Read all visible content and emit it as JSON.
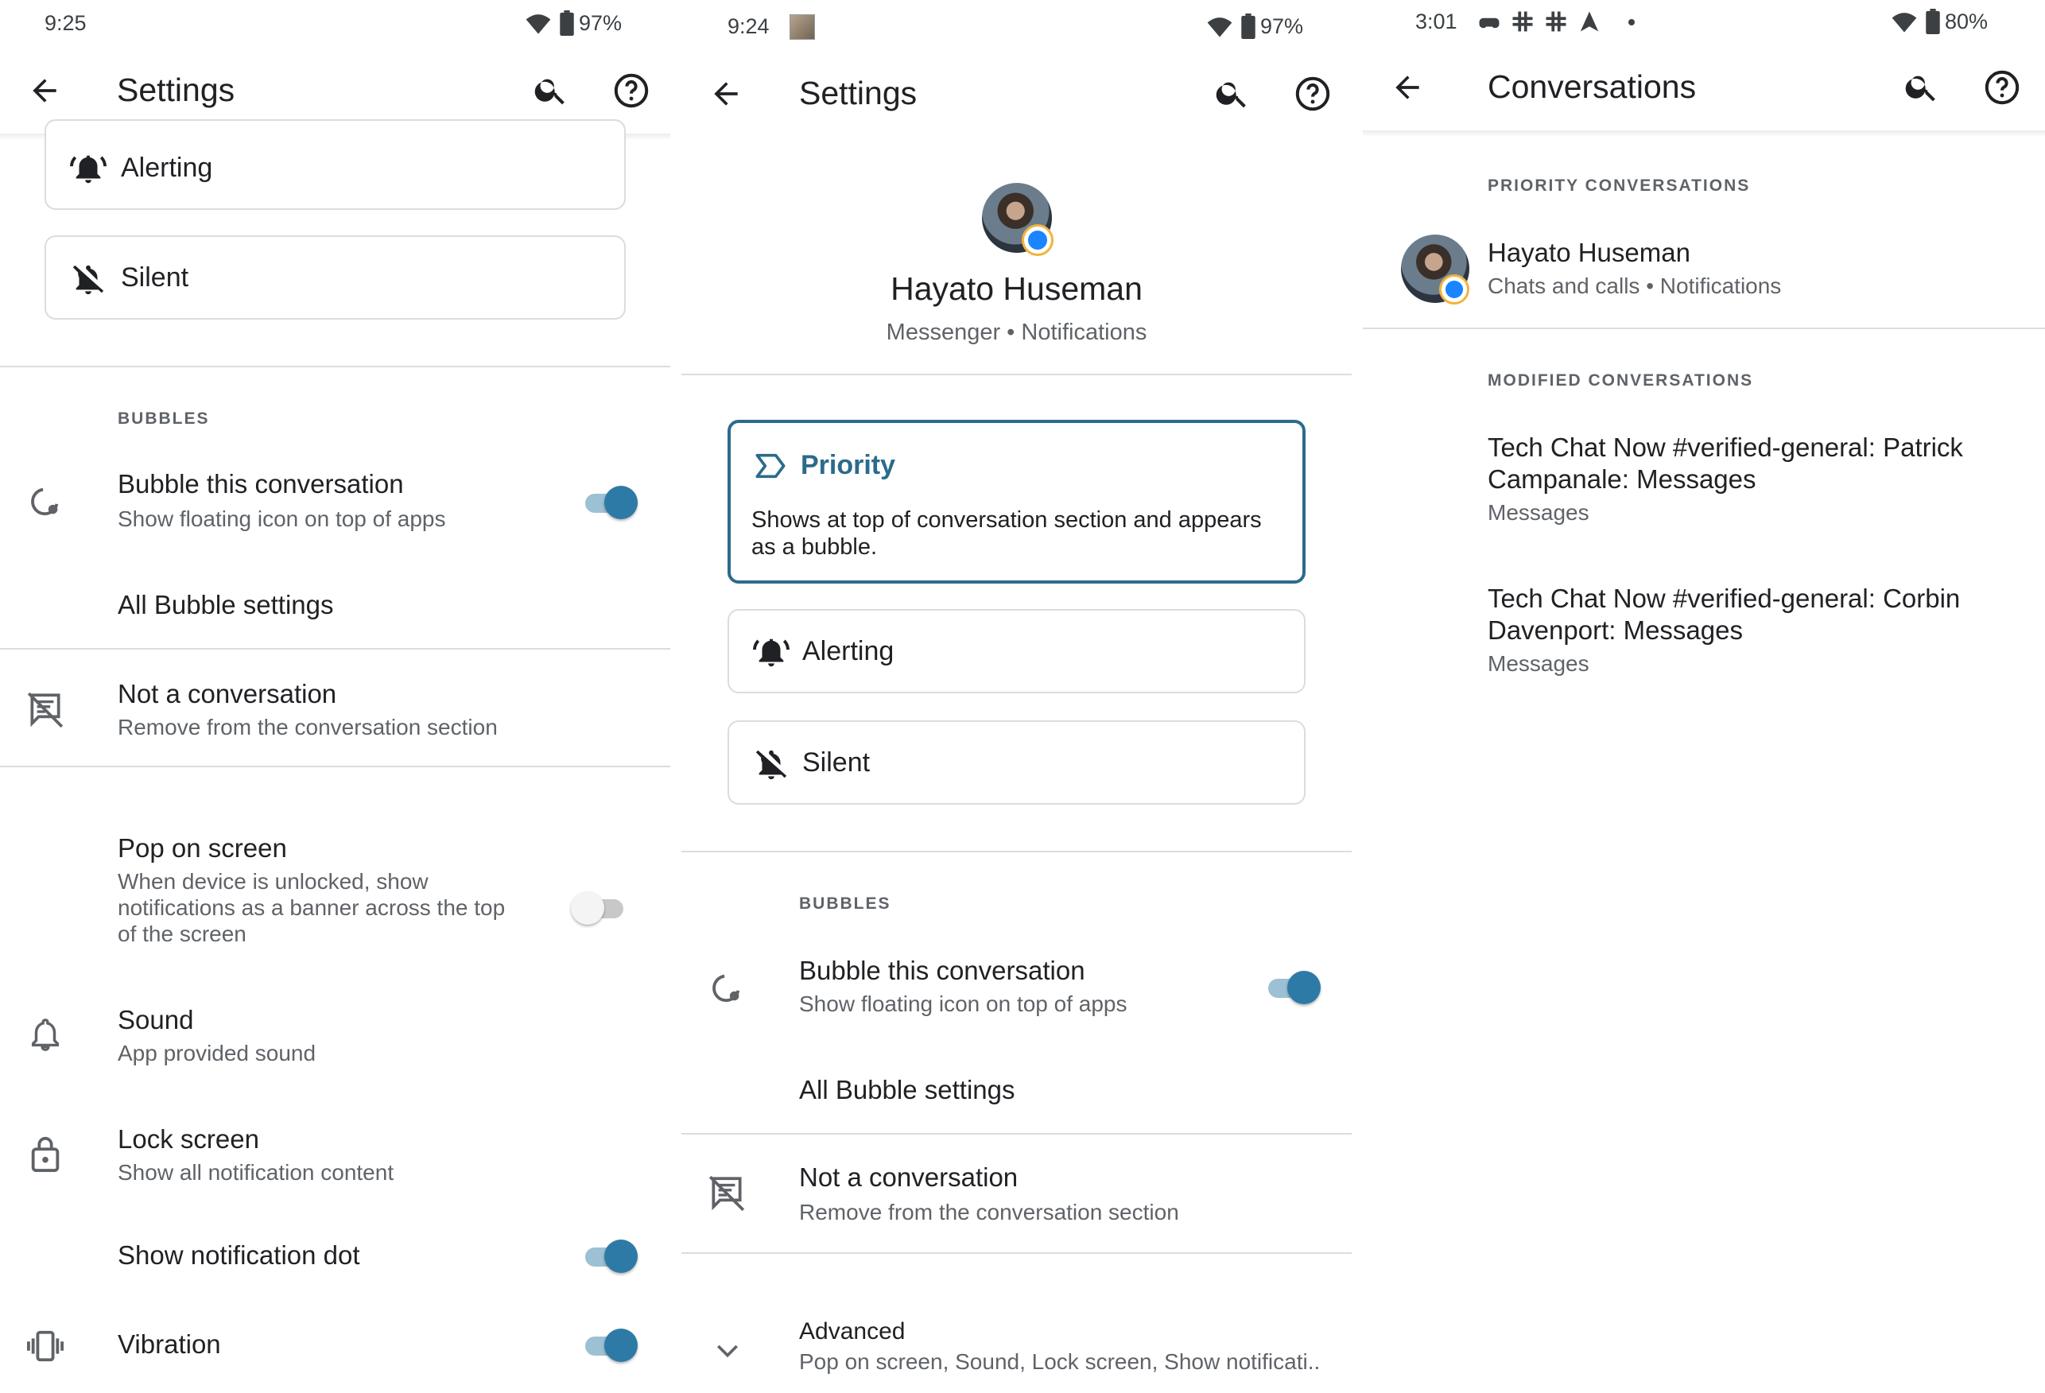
{
  "colors": {
    "accent": "#2b6b8c",
    "toggle_on": "#2e7aa6",
    "divider": "#dadce0",
    "secondary_text": "#5f6368"
  },
  "panel1": {
    "status_time": "9:25",
    "battery": "97%",
    "title": "Settings",
    "cards": {
      "alerting": "Alerting",
      "silent": "Silent"
    },
    "bubbles_header": "BUBBLES",
    "bubble": {
      "title": "Bubble this conversation",
      "sub": "Show floating icon on top of apps",
      "on": true
    },
    "all_bubble": "All Bubble settings",
    "not_conv": {
      "title": "Not a conversation",
      "sub": "Remove from the conversation section"
    },
    "pop": {
      "title": "Pop on screen",
      "sub1": "When device is unlocked, show",
      "sub2": "notifications as a banner across the top",
      "sub3": "of the screen",
      "on": false
    },
    "sound": {
      "title": "Sound",
      "sub": "App provided sound"
    },
    "lock": {
      "title": "Lock screen",
      "sub": "Show all notification content"
    },
    "dot": {
      "title": "Show notification dot",
      "on": true
    },
    "vibration": {
      "title": "Vibration",
      "on": true
    }
  },
  "panel2": {
    "status_time": "9:24",
    "battery": "97%",
    "title": "Settings",
    "contact": {
      "name": "Hayato Huseman",
      "sub": "Messenger • Notifications"
    },
    "priority": {
      "title": "Priority",
      "desc1": "Shows at top of conversation section and appears",
      "desc2": "as a bubble."
    },
    "cards": {
      "alerting": "Alerting",
      "silent": "Silent"
    },
    "bubbles_header": "BUBBLES",
    "bubble": {
      "title": "Bubble this conversation",
      "sub": "Show floating icon on top of apps",
      "on": true
    },
    "all_bubble": "All Bubble settings",
    "not_conv": {
      "title": "Not a conversation",
      "sub": "Remove from the conversation section"
    },
    "advanced": {
      "title": "Advanced",
      "sub": "Pop on screen, Sound, Lock screen, Show notificati.."
    }
  },
  "panel3": {
    "status_time": "3:01",
    "battery": "80%",
    "title": "Conversations",
    "priority_header": "PRIORITY CONVERSATIONS",
    "priority_item": {
      "name": "Hayato Huseman",
      "sub": "Chats and calls • Notifications"
    },
    "modified_header": "MODIFIED CONVERSATIONS",
    "modified": [
      {
        "line1": "Tech Chat Now #verified-general: Patrick",
        "line2": "Campanale: Messages",
        "sub": "Messages"
      },
      {
        "line1": "Tech Chat Now #verified-general: Corbin",
        "line2": "Davenport: Messages",
        "sub": "Messages"
      }
    ]
  }
}
